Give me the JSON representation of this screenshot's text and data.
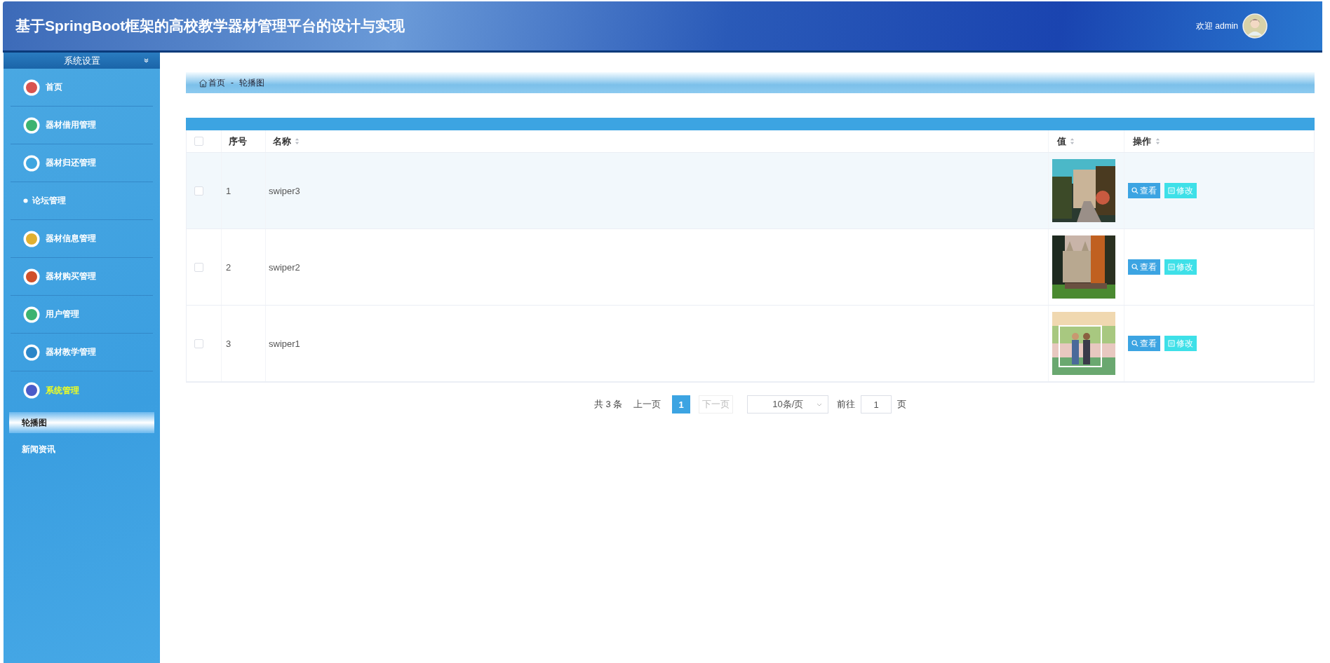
{
  "header": {
    "title": "基于SpringBoot框架的高校教学器材管理平台的设计与实现",
    "welcome": "欢迎 admin"
  },
  "sidebar": {
    "title": "系统设置",
    "items": [
      {
        "label": "首页",
        "kind": "circle",
        "color": "#d9534f",
        "expanded": false
      },
      {
        "label": "器材借用管理",
        "kind": "circle",
        "color": "#3cb371",
        "expanded": false
      },
      {
        "label": "器材归还管理",
        "kind": "circle",
        "color": "#3ea6e0",
        "expanded": false
      },
      {
        "label": "论坛管理",
        "kind": "dot",
        "color": "#ffffff",
        "expanded": false
      },
      {
        "label": "器材信息管理",
        "kind": "circle",
        "color": "#e0b030",
        "expanded": false
      },
      {
        "label": "器材购买管理",
        "kind": "circle",
        "color": "#d0502a",
        "expanded": false
      },
      {
        "label": "用户管理",
        "kind": "circle",
        "color": "#3cb371",
        "expanded": false
      },
      {
        "label": "器材教学管理",
        "kind": "circle",
        "color": "#2a86c8",
        "expanded": false
      },
      {
        "label": "系统管理",
        "kind": "circle",
        "color": "#4a5bc8",
        "expanded": true,
        "children": [
          {
            "label": "轮播图",
            "selected": true
          },
          {
            "label": "新闻资讯",
            "selected": false
          }
        ]
      }
    ]
  },
  "breadcrumb": [
    "首页",
    "-",
    "轮播图"
  ],
  "table": {
    "select_all": {
      "checked": false
    },
    "columns": [
      {
        "label": "序号",
        "sortable": false
      },
      {
        "label": "名称",
        "sortable": true
      },
      {
        "label": "值",
        "sortable": true
      },
      {
        "label": "操作",
        "sortable": true
      }
    ],
    "rows": [
      {
        "checked": false,
        "hovered": true,
        "index": "1",
        "name": "swiper3",
        "value": {
          "kind": "picture"
        },
        "actions": [
          "查看",
          "修改"
        ]
      },
      {
        "checked": false,
        "hovered": false,
        "index": "2",
        "name": "swiper2",
        "value": {
          "kind": "picture"
        },
        "actions": [
          "查看",
          "修改"
        ]
      },
      {
        "checked": false,
        "hovered": false,
        "index": "3",
        "name": "swiper1",
        "value": {
          "kind": "picture"
        },
        "actions": [
          "查看",
          "修改"
        ]
      }
    ]
  },
  "pagination": {
    "total": "共 3 条",
    "prev": "上一页",
    "pages": [
      {
        "label": "1",
        "selected": true
      }
    ],
    "next": "下一页",
    "page_size": "10条/页",
    "goto": "前往",
    "goto_value": "1",
    "page_unit": "页"
  }
}
